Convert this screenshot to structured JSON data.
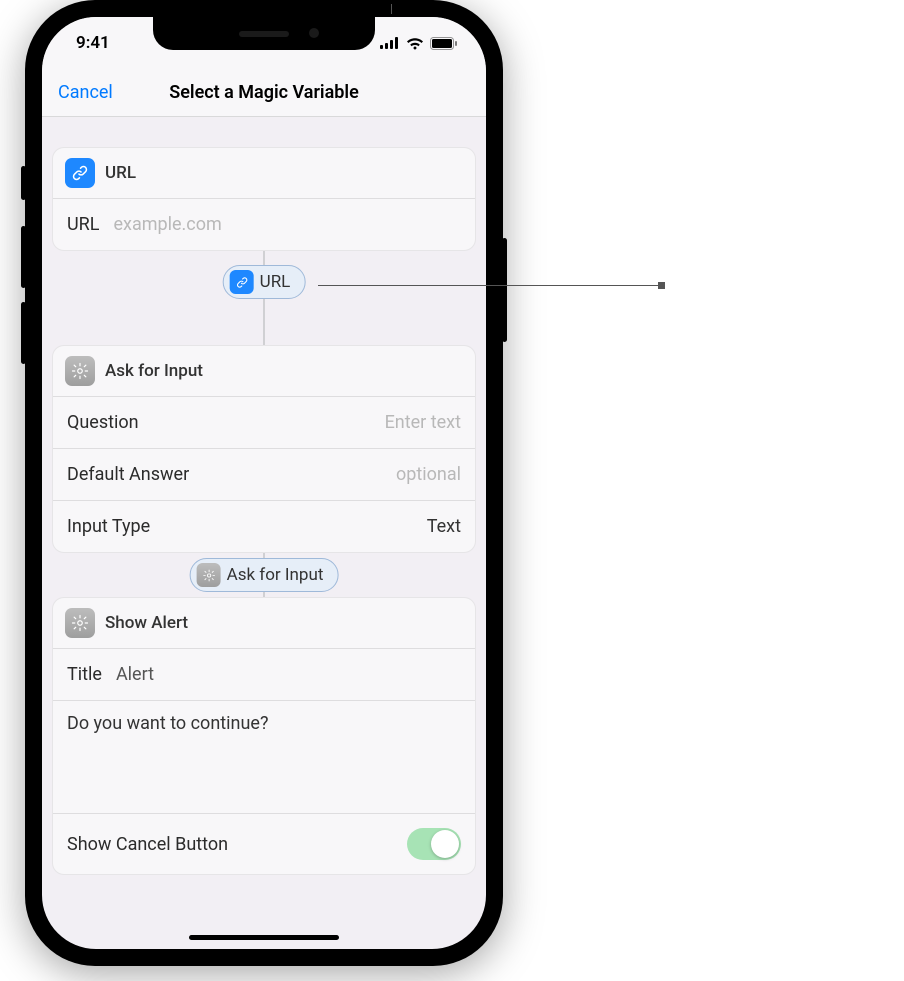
{
  "status": {
    "time": "9:41"
  },
  "nav": {
    "cancel": "Cancel",
    "title": "Select a Magic Variable"
  },
  "cards": {
    "url": {
      "title": "URL",
      "field_label": "URL",
      "placeholder": "example.com"
    },
    "ask": {
      "title": "Ask for Input",
      "question_label": "Question",
      "question_placeholder": "Enter text",
      "default_label": "Default Answer",
      "default_placeholder": "optional",
      "input_type_label": "Input Type",
      "input_type_value": "Text"
    },
    "alert": {
      "title": "Show Alert",
      "title_label": "Title",
      "title_value": "Alert",
      "message": "Do you want to continue?",
      "cancel_label": "Show Cancel Button",
      "cancel_on": true
    }
  },
  "pills": {
    "url": "URL",
    "ask": "Ask for Input"
  }
}
